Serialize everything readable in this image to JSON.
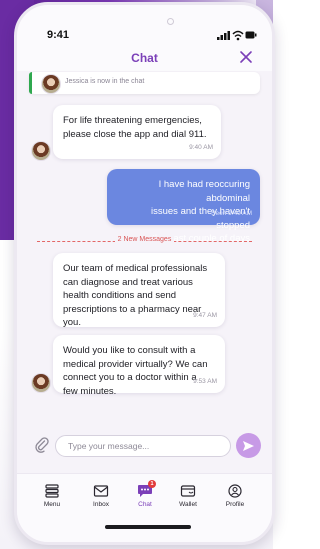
{
  "status_bar": {
    "time": "9:41"
  },
  "header": {
    "title": "Chat"
  },
  "system_notice": {
    "text": "Jessica is now in the chat"
  },
  "messages": [
    {
      "direction": "incoming",
      "text": "For life threatening emergencies,\nplease close the app and dial 911.",
      "time": "9:40 AM"
    },
    {
      "direction": "outgoing",
      "text": "I have had reoccuring abdominal\nissues and they haven't stopped\nthe past couple of days",
      "time": "Seen 9:40 AM"
    },
    {
      "direction": "incoming",
      "text": "Our team of medical professionals\ncan diagnose and treat various\nhealth conditions and send\nprescriptions to a pharmacy near\nyou.",
      "time": "9:47 AM"
    },
    {
      "direction": "incoming",
      "text": "Would you like to consult with a\nmedical provider virtually? We can\nconnect you to a doctor within a\nfew minutes.",
      "time": "9:53 AM"
    }
  ],
  "divider": {
    "text": "2 New Messages"
  },
  "composer": {
    "placeholder": "Type your message..."
  },
  "tabs": [
    {
      "label": "Menu",
      "icon": "menu-icon"
    },
    {
      "label": "Inbox",
      "icon": "envelope-icon"
    },
    {
      "label": "Chat",
      "icon": "chat-icon",
      "active": true,
      "badge": "1"
    },
    {
      "label": "Wallet",
      "icon": "wallet-icon"
    },
    {
      "label": "Profile",
      "icon": "profile-icon"
    }
  ],
  "colors": {
    "brand_purple": "#7b3fb8",
    "outgoing_bubble": "#6b87e0",
    "new_messages_red": "#d95555",
    "online_green": "#2fa84f",
    "send_button": "#c79ae6"
  }
}
